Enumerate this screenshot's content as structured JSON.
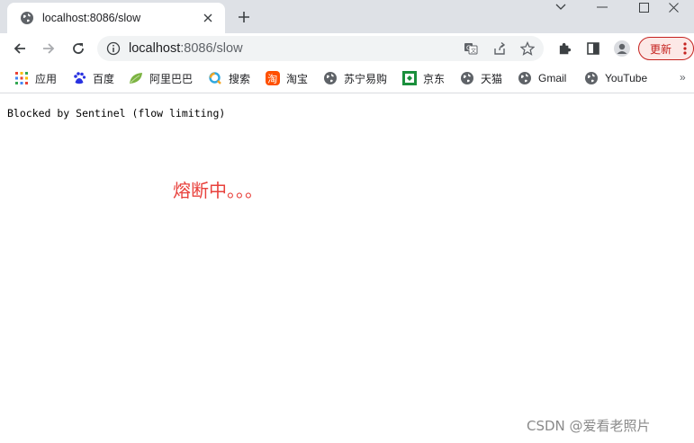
{
  "tab": {
    "title": "localhost:8086/slow"
  },
  "omnibox": {
    "host": "localhost",
    "path": ":8086/slow"
  },
  "toolbar": {
    "update_label": "更新"
  },
  "bookmarks": [
    {
      "label": "应用",
      "icon": "apps-grid-icon"
    },
    {
      "label": "百度",
      "icon": "baidu-paw-icon"
    },
    {
      "label": "阿里巴巴",
      "icon": "alibaba-leaf-icon"
    },
    {
      "label": "搜索",
      "icon": "search-ring-icon"
    },
    {
      "label": "淘宝",
      "icon": "taobao-icon"
    },
    {
      "label": "苏宁易购",
      "icon": "globe-icon"
    },
    {
      "label": "京东",
      "icon": "jd-icon"
    },
    {
      "label": "天猫",
      "icon": "globe-icon"
    },
    {
      "label": "Gmail",
      "icon": "globe-icon"
    },
    {
      "label": "YouTube",
      "icon": "globe-icon"
    }
  ],
  "bookmarks_more": "»",
  "page": {
    "blocked_text": "Blocked by Sentinel (flow limiting)",
    "fuse_text": "熔断中。。。"
  },
  "watermark": "CSDN @爱看老照片",
  "colors": {
    "tabstrip": "#dee1e6",
    "fuse_text": "#e8413c",
    "update_accent": "#c5221f"
  }
}
